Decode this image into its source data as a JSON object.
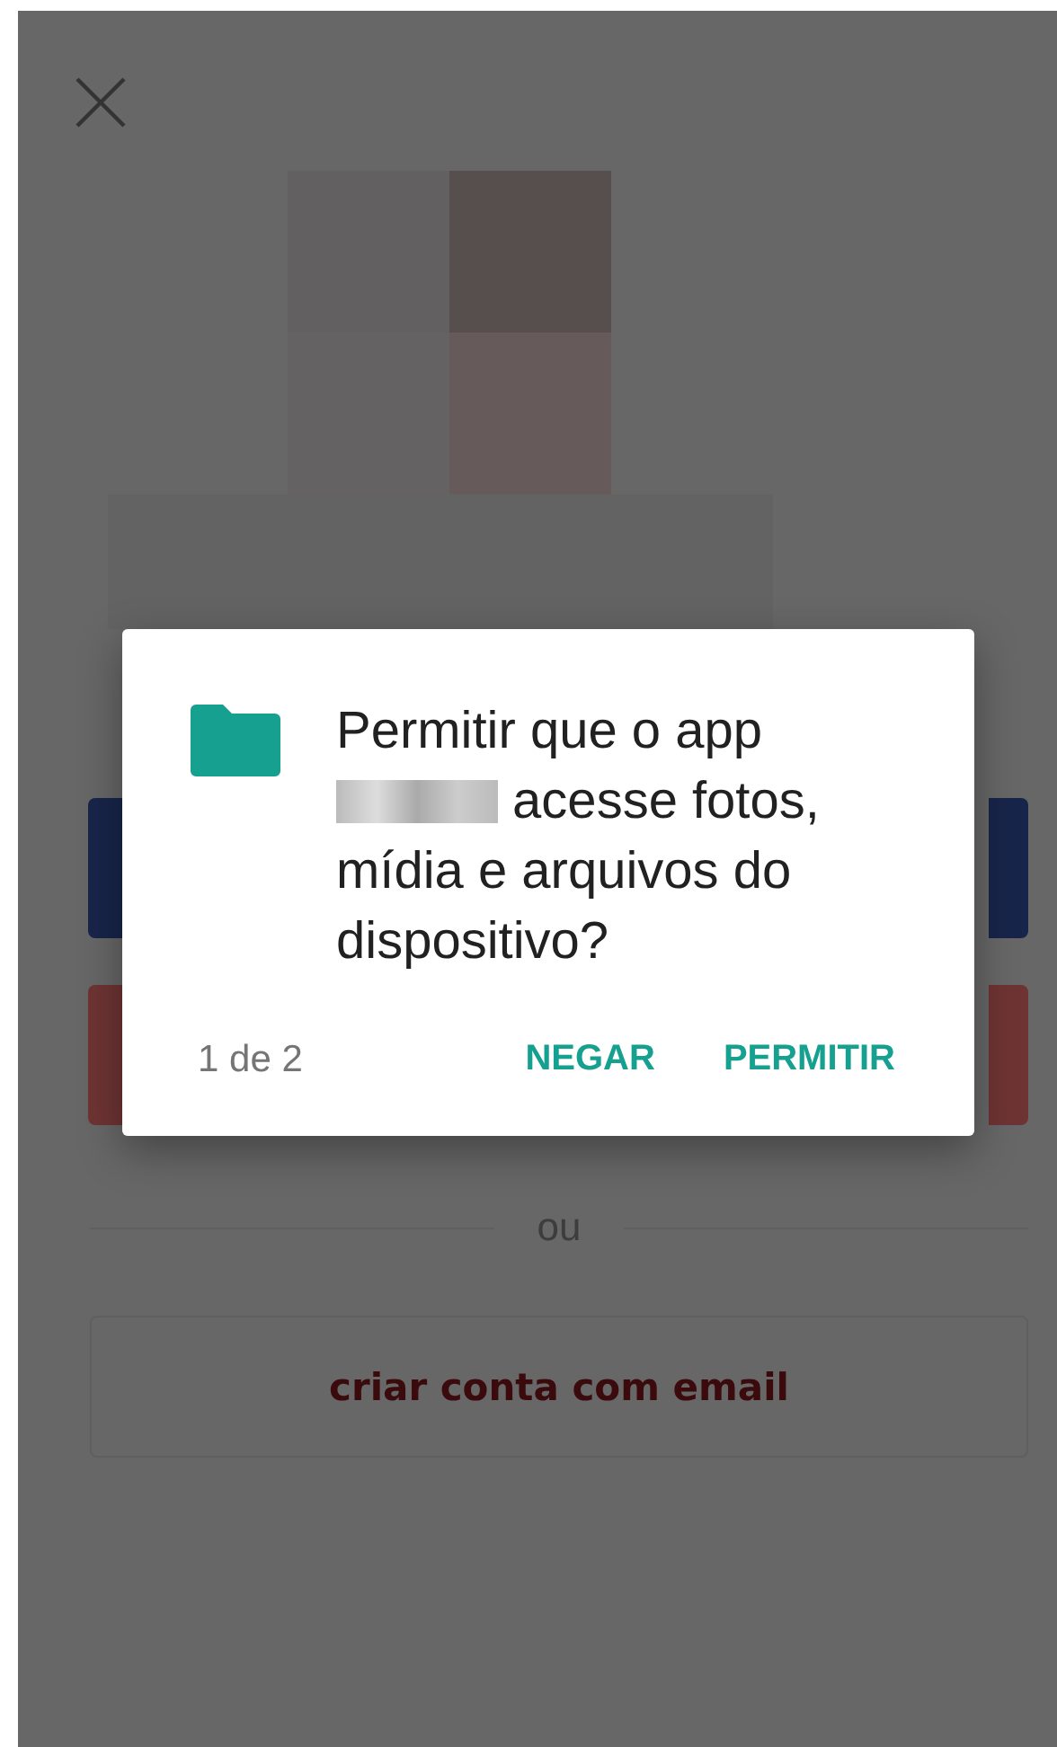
{
  "screen": {
    "divider_label": "ou",
    "email_button": "criar conta com email"
  },
  "dialog": {
    "message_start": "Permitir que o app",
    "message_end": "acesse fotos, mídia e arquivos do dispositivo?",
    "counter": "1 de 2",
    "buttons": [
      {
        "label": "NEGAR",
        "kind": "deny"
      },
      {
        "label": "PERMITIR",
        "kind": "allow"
      }
    ]
  }
}
